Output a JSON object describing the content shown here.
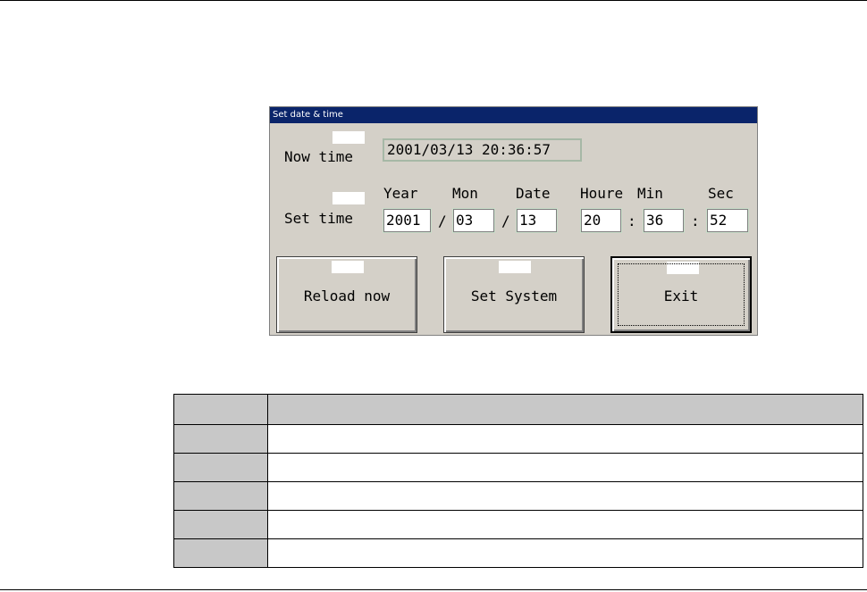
{
  "dialog": {
    "title": "Set date & time",
    "now_label": "Now time",
    "now_value": "2001/03/13 20:36:57",
    "set_label": "Set time",
    "headers": {
      "year": "Year",
      "mon": "Mon",
      "date": "Date",
      "hour": "Houre",
      "min": "Min",
      "sec": "Sec"
    },
    "fields": {
      "year": "2001",
      "mon": "03",
      "date": "13",
      "hour": "20",
      "min": "36",
      "sec": "52"
    },
    "separators": {
      "date_sep": "/",
      "time_sep": ":"
    },
    "buttons": {
      "reload": "Reload now",
      "set_system": "Set System",
      "exit": "Exit"
    }
  },
  "colors": {
    "titlebar": "#0a246a",
    "window": "#d4d0c8",
    "table_shade": "#c8c8c8"
  }
}
